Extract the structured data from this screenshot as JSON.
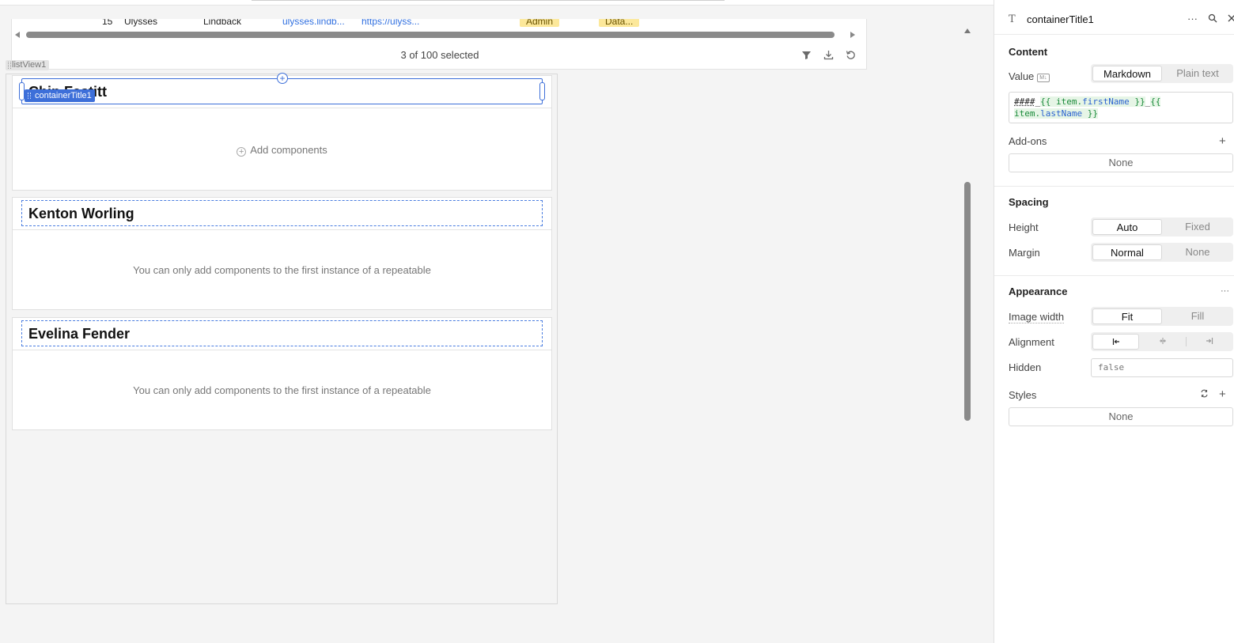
{
  "table": {
    "row": {
      "id": "15",
      "first": "Ulysses",
      "last": "Lindback",
      "email": "ulysses.lindb...",
      "url": "https://ulyss...",
      "role": "Admin",
      "team": "Data..."
    },
    "status": "3 of 100 selected",
    "icons": [
      "filter-icon",
      "download-icon",
      "refresh-icon"
    ]
  },
  "listview": {
    "label": "listView1",
    "selected_component": "containerTitle1",
    "add_components": "Add components",
    "items": [
      {
        "title": "Chip Fastitt"
      },
      {
        "title": "Kenton Worling",
        "message": "You can only add components to the first instance of a repeatable"
      },
      {
        "title": "Evelina Fender",
        "message": "You can only add components to the first instance of a repeatable"
      }
    ]
  },
  "inspector": {
    "component_name": "containerTitle1",
    "content": {
      "section": "Content",
      "value_label": "Value",
      "value_badge": "M↓",
      "modes": [
        "Markdown",
        "Plain text"
      ],
      "selected_mode": "Markdown",
      "code_hash": "####",
      "code_open1": "{{ ",
      "code_item1": "item.",
      "code_prop1": "firstName",
      "code_close1": " }}",
      "code_open2": "{{ ",
      "code_item2": "item.",
      "code_prop2": "lastName",
      "code_close2": " }}",
      "addons_label": "Add-ons",
      "addons_value": "None"
    },
    "spacing": {
      "section": "Spacing",
      "height_label": "Height",
      "height_options": [
        "Auto",
        "Fixed"
      ],
      "margin_label": "Margin",
      "margin_options": [
        "Normal",
        "None"
      ]
    },
    "appearance": {
      "section": "Appearance",
      "more": "···",
      "image_width_label": "Image width",
      "image_width_options": [
        "Fit",
        "Fill"
      ],
      "alignment_label": "Alignment",
      "hidden_label": "Hidden",
      "hidden_value": "false",
      "styles_label": "Styles",
      "styles_value": "None"
    }
  },
  "colors": {
    "accent": "#3d6fd9",
    "tag_yellow": "#fce89a",
    "link": "#3170e0"
  }
}
